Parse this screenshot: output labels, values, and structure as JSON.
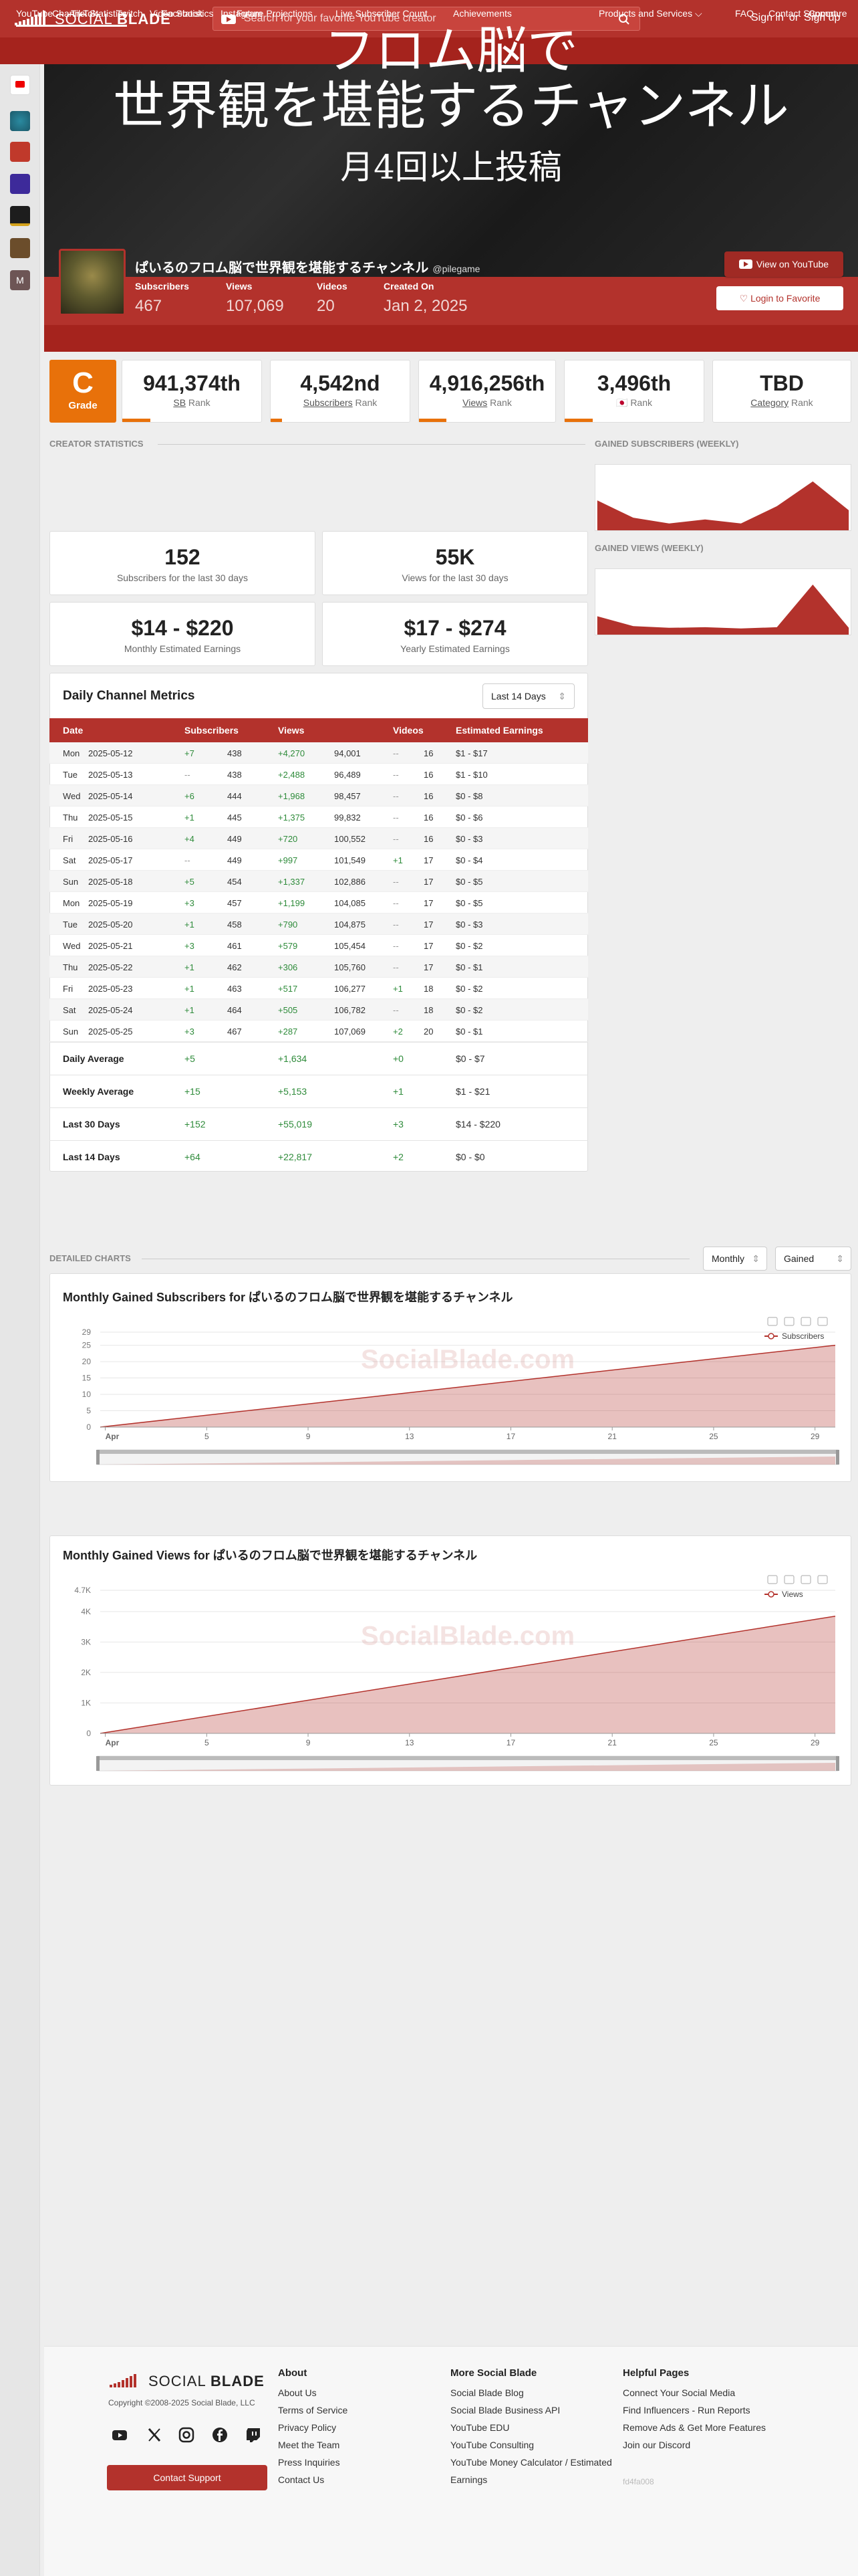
{
  "brand": {
    "logo_regular": "SOCIAL ",
    "logo_bold": "BLADE"
  },
  "search": {
    "placeholder": "Search for your favorite YouTube creator"
  },
  "auth": {
    "sign_in": "Sign in",
    "or": "or",
    "sign_up": "Sign up"
  },
  "nav": {
    "youtube": "YouTube",
    "tiktok": "TikTok",
    "twitch": "Twitch",
    "facebook": "Facebook",
    "instagram": "Instagram",
    "products": "Products and Services",
    "faq": "FAQ",
    "contact": "Contact Support"
  },
  "banner": {
    "line1": "フロム脳で",
    "line2": "世界観を堪能するチャンネル",
    "line3": "月4回以上投稿"
  },
  "channel": {
    "name": "ぱいるのフロム脳で世界観を堪能するチャンネル",
    "handle": "@pilegame",
    "subscribers_label": "Subscribers",
    "subscribers": "467",
    "views_label": "Views",
    "views": "107,069",
    "videos_label": "Videos",
    "videos": "20",
    "created_label": "Created On",
    "created": "Jan 2, 2025",
    "view_on_youtube": "View on YouTube",
    "login_favorite": "Login to Favorite"
  },
  "tabs": {
    "channel_statistics": "Channel Statistics",
    "video_statistics": "Video Statistics",
    "future_projections": "Future Projections",
    "live_count": "Live Subscriber Count",
    "achievements": "Achievements",
    "compare": "Compare"
  },
  "grade": {
    "letter": "C",
    "label": "Grade"
  },
  "ranks": [
    {
      "value": "941,374th",
      "prefix": "",
      "link": "SB",
      "suffix": " Rank",
      "fill": 0.2
    },
    {
      "value": "4,542nd",
      "prefix": "",
      "link": "Subscribers",
      "suffix": " Rank",
      "fill": 0.08
    },
    {
      "value": "4,916,256th",
      "prefix": "",
      "link": "Views",
      "suffix": " Rank",
      "fill": 0.2
    },
    {
      "value": "3,496th",
      "prefix": "🇯🇵 ",
      "link": "",
      "suffix": "Rank",
      "fill": 0.2
    },
    {
      "value": "TBD",
      "prefix": "",
      "link": "Category",
      "suffix": " Rank",
      "fill": 0
    }
  ],
  "sections": {
    "creator_statistics": "Creator Statistics",
    "gained_subscribers_weekly": "Gained Subscribers (Weekly)",
    "gained_views_weekly": "Gained Views (Weekly)",
    "detailed_charts": "Detailed Charts"
  },
  "stat_boxes": [
    {
      "value": "152",
      "label": "Subscribers for the last 30 days"
    },
    {
      "value": "55K",
      "label": "Views for the last 30 days"
    },
    {
      "value": "$14 - $220",
      "label": "Monthly Estimated Earnings"
    },
    {
      "value": "$17 - $274",
      "label": "Yearly Estimated Earnings"
    }
  ],
  "metrics": {
    "title": "Daily Channel Metrics",
    "range": "Last 14 Days",
    "headers": {
      "date": "Date",
      "subscribers": "Subscribers",
      "views": "Views",
      "videos": "Videos",
      "earnings": "Estimated Earnings"
    },
    "rows": [
      {
        "day": "Mon",
        "date": "2025-05-12",
        "sub_d": "+7",
        "sub": "438",
        "view_d": "+4,270",
        "view": "94,001",
        "vid_d": "--",
        "vid": "16",
        "earn": "$1 - $17"
      },
      {
        "day": "Tue",
        "date": "2025-05-13",
        "sub_d": "--",
        "sub": "438",
        "view_d": "+2,488",
        "view": "96,489",
        "vid_d": "--",
        "vid": "16",
        "earn": "$1 - $10"
      },
      {
        "day": "Wed",
        "date": "2025-05-14",
        "sub_d": "+6",
        "sub": "444",
        "view_d": "+1,968",
        "view": "98,457",
        "vid_d": "--",
        "vid": "16",
        "earn": "$0 - $8"
      },
      {
        "day": "Thu",
        "date": "2025-05-15",
        "sub_d": "+1",
        "sub": "445",
        "view_d": "+1,375",
        "view": "99,832",
        "vid_d": "--",
        "vid": "16",
        "earn": "$0 - $6"
      },
      {
        "day": "Fri",
        "date": "2025-05-16",
        "sub_d": "+4",
        "sub": "449",
        "view_d": "+720",
        "view": "100,552",
        "vid_d": "--",
        "vid": "16",
        "earn": "$0 - $3"
      },
      {
        "day": "Sat",
        "date": "2025-05-17",
        "sub_d": "--",
        "sub": "449",
        "view_d": "+997",
        "view": "101,549",
        "vid_d": "+1",
        "vid": "17",
        "earn": "$0 - $4"
      },
      {
        "day": "Sun",
        "date": "2025-05-18",
        "sub_d": "+5",
        "sub": "454",
        "view_d": "+1,337",
        "view": "102,886",
        "vid_d": "--",
        "vid": "17",
        "earn": "$0 - $5"
      },
      {
        "day": "Mon",
        "date": "2025-05-19",
        "sub_d": "+3",
        "sub": "457",
        "view_d": "+1,199",
        "view": "104,085",
        "vid_d": "--",
        "vid": "17",
        "earn": "$0 - $5"
      },
      {
        "day": "Tue",
        "date": "2025-05-20",
        "sub_d": "+1",
        "sub": "458",
        "view_d": "+790",
        "view": "104,875",
        "vid_d": "--",
        "vid": "17",
        "earn": "$0 - $3"
      },
      {
        "day": "Wed",
        "date": "2025-05-21",
        "sub_d": "+3",
        "sub": "461",
        "view_d": "+579",
        "view": "105,454",
        "vid_d": "--",
        "vid": "17",
        "earn": "$0 - $2"
      },
      {
        "day": "Thu",
        "date": "2025-05-22",
        "sub_d": "+1",
        "sub": "462",
        "view_d": "+306",
        "view": "105,760",
        "vid_d": "--",
        "vid": "17",
        "earn": "$0 - $1"
      },
      {
        "day": "Fri",
        "date": "2025-05-23",
        "sub_d": "+1",
        "sub": "463",
        "view_d": "+517",
        "view": "106,277",
        "vid_d": "+1",
        "vid": "18",
        "earn": "$0 - $2"
      },
      {
        "day": "Sat",
        "date": "2025-05-24",
        "sub_d": "+1",
        "sub": "464",
        "view_d": "+505",
        "view": "106,782",
        "vid_d": "--",
        "vid": "18",
        "earn": "$0 - $2"
      },
      {
        "day": "Sun",
        "date": "2025-05-25",
        "sub_d": "+3",
        "sub": "467",
        "view_d": "+287",
        "view": "107,069",
        "vid_d": "+2",
        "vid": "20",
        "earn": "$0 - $1"
      }
    ],
    "summary": [
      {
        "label": "Daily Average",
        "sub": "+5",
        "view": "+1,634",
        "vid": "+0",
        "earn": "$0 - $7"
      },
      {
        "label": "Weekly Average",
        "sub": "+15",
        "view": "+5,153",
        "vid": "+1",
        "earn": "$1 - $21"
      },
      {
        "label": "Last 30 Days",
        "sub": "+152",
        "view": "+55,019",
        "vid": "+3",
        "earn": "$14 - $220"
      },
      {
        "label": "Last 14 Days",
        "sub": "+64",
        "view": "+22,817",
        "vid": "+2",
        "earn": "$0 - $0"
      }
    ]
  },
  "detailed": {
    "period": "Monthly",
    "mode": "Gained"
  },
  "chart_data": [
    {
      "type": "area",
      "title": "Monthly Gained Subscribers for ぱいるのフロム脳で世界観を堪能するチャンネル",
      "watermark": "SocialBlade.com",
      "x_ticks": [
        "Apr",
        "5",
        "9",
        "13",
        "17",
        "21",
        "25",
        "29"
      ],
      "y_ticks": [
        "0",
        "5",
        "10",
        "15",
        "20",
        "25",
        "29"
      ],
      "ylim": [
        0,
        29
      ],
      "series": [
        {
          "name": "Subscribers",
          "x": [
            0,
            29
          ],
          "values": [
            0,
            25
          ]
        }
      ],
      "legend_position": "top-right",
      "grid": true,
      "color": "#b3322c"
    },
    {
      "type": "area",
      "title": "Monthly Gained Views for ぱいるのフロム脳で世界観を堪能するチャンネル",
      "watermark": "SocialBlade.com",
      "x_ticks": [
        "Apr",
        "5",
        "9",
        "13",
        "17",
        "21",
        "25",
        "29"
      ],
      "y_ticks": [
        "0",
        "1K",
        "2K",
        "3K",
        "4K",
        "4.7K"
      ],
      "y_tick_values": [
        0,
        1000,
        2000,
        3000,
        4000,
        4700
      ],
      "ylim": [
        0,
        4700
      ],
      "series": [
        {
          "name": "Views",
          "x": [
            0,
            29
          ],
          "values": [
            0,
            3850
          ]
        }
      ],
      "legend_position": "top-right",
      "grid": true,
      "color": "#b3322c"
    }
  ],
  "weekly_subscribers": {
    "values": [
      0.45,
      0.15,
      0.05,
      0.12,
      0.05,
      0.35,
      0.78,
      0.28
    ]
  },
  "weekly_views": {
    "values": [
      0.25,
      0.08,
      0.05,
      0.06,
      0.04,
      0.06,
      0.8,
      0.05
    ]
  },
  "footer": {
    "logo_regular": "SOCIAL ",
    "logo_bold": "BLADE",
    "copyright": "Copyright ©2008-2025 Social Blade, LLC",
    "contact": "Contact Support",
    "about_head": "About",
    "about": [
      "About Us",
      "Terms of Service",
      "Privacy Policy",
      "Meet the Team",
      "Press Inquiries",
      "Contact Us"
    ],
    "more_head": "More Social Blade",
    "more": [
      "Social Blade Blog",
      "Social Blade Business API",
      "YouTube EDU",
      "YouTube Consulting",
      "YouTube Money Calculator / Estimated",
      "Earnings"
    ],
    "help_head": "Helpful Pages",
    "help": [
      "Connect Your Social Media",
      "Find Influencers - Run Reports",
      "Remove Ads & Get More Features",
      "Join our Discord"
    ],
    "build": "fd4fa008"
  },
  "colors": {
    "brand": "#b3322c",
    "brand_dark": "#a5231d",
    "grade": "#e8710a",
    "positive": "#2e8b3a"
  }
}
